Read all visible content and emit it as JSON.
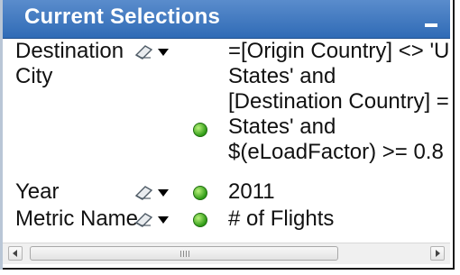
{
  "panel": {
    "title": "Current Selections"
  },
  "selections": [
    {
      "field_lines": [
        "Destination",
        "City"
      ],
      "value_lines": [
        "=[Origin Country] <> 'United",
        "States' and",
        "[Destination Country] = 'United",
        "States' and",
        "$(eLoadFactor) >= 0.8"
      ]
    },
    {
      "field_lines": [
        "Year"
      ],
      "value_lines": [
        "2011"
      ]
    },
    {
      "field_lines": [
        "Metric Name"
      ],
      "value_lines": [
        "# of Flights"
      ]
    }
  ],
  "colors": {
    "title_bar": "#3f78c1",
    "selected_dot": "#2e9a16"
  },
  "icons": {
    "clear": "eraser-icon",
    "dropdown": "dropdown-arrow-icon",
    "state": "green-dot-icon",
    "minimize": "minimize-icon"
  }
}
